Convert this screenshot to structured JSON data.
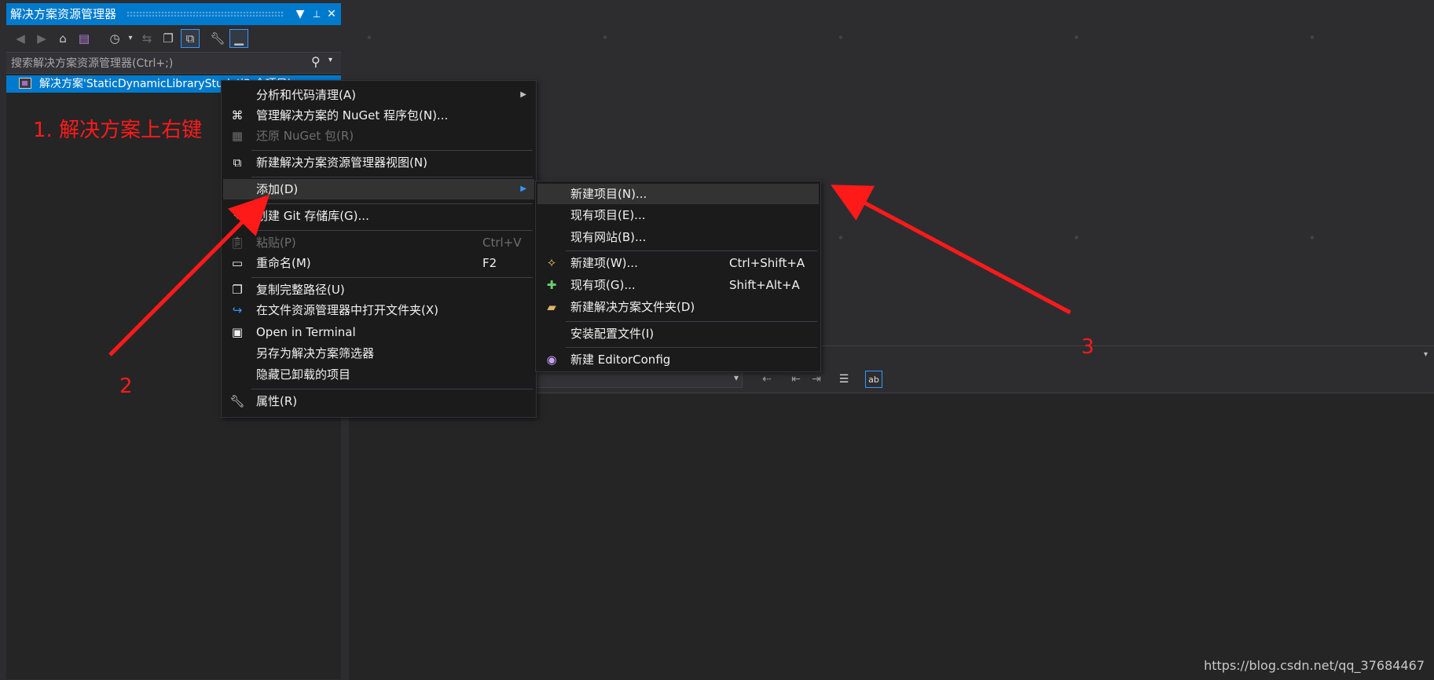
{
  "solution_explorer": {
    "title": "解决方案资源管理器",
    "title_buttons": [
      "▼",
      "📌",
      "✕"
    ],
    "toolbar_icons": [
      "back-icon",
      "forward-icon",
      "home-icon",
      "switch-views-icon",
      "history-icon",
      "sync-icon",
      "collapse-all-icon",
      "show-all-files-icon",
      "properties-icon",
      "preview-icon"
    ],
    "search_placeholder": "搜索解决方案资源管理器(Ctrl+;)",
    "tree_item": "解决方案'StaticDynamicLibraryStudy'(2 个项目)"
  },
  "context_menu": {
    "items": [
      {
        "label": "分析和代码清理(A)",
        "shortcut": "",
        "submenu": true,
        "icon": ""
      },
      {
        "label": "管理解决方案的 NuGet 程序包(N)...",
        "shortcut": "",
        "icon": "nuget-icon"
      },
      {
        "label": "还原 NuGet 包(R)",
        "shortcut": "",
        "icon": "restore-icon",
        "disabled": true
      },
      {
        "label": "新建解决方案资源管理器视图(N)",
        "shortcut": "",
        "icon": "new-view-icon"
      },
      {
        "label": "添加(D)",
        "shortcut": "",
        "submenu": true,
        "highlighted": true
      },
      {
        "label": "创建 Git 存储库(G)...",
        "shortcut": "",
        "icon": "git-icon"
      },
      {
        "label": "粘贴(P)",
        "shortcut": "Ctrl+V",
        "icon": "paste-icon",
        "disabled": true
      },
      {
        "label": "重命名(M)",
        "shortcut": "F2",
        "icon": "rename-icon"
      },
      {
        "label": "复制完整路径(U)",
        "shortcut": "",
        "icon": "copy-icon"
      },
      {
        "label": "在文件资源管理器中打开文件夹(X)",
        "shortcut": "",
        "icon": "open-folder-icon"
      },
      {
        "label": "Open in Terminal",
        "shortcut": "",
        "icon": "terminal-icon"
      },
      {
        "label": "另存为解决方案筛选器",
        "shortcut": ""
      },
      {
        "label": "隐藏已卸载的项目",
        "shortcut": ""
      },
      {
        "label": "属性(R)",
        "shortcut": "",
        "icon": "wrench-icon"
      }
    ]
  },
  "add_submenu": {
    "items": [
      {
        "label": "新建项目(N)...",
        "shortcut": "",
        "highlighted": true
      },
      {
        "label": "现有项目(E)...",
        "shortcut": ""
      },
      {
        "label": "现有网站(B)...",
        "shortcut": ""
      },
      {
        "label": "新建项(W)...",
        "shortcut": "Ctrl+Shift+A",
        "icon": "new-item-icon"
      },
      {
        "label": "现有项(G)...",
        "shortcut": "Shift+Alt+A",
        "icon": "existing-item-icon"
      },
      {
        "label": "新建解决方案文件夹(D)",
        "shortcut": "",
        "icon": "new-folder-icon"
      },
      {
        "label": "安装配置文件(I)",
        "shortcut": ""
      },
      {
        "label": "新建 EditorConfig",
        "shortcut": "",
        "icon": "editorconfig-icon"
      }
    ]
  },
  "annotations": {
    "step1": "1. 解决方案上右键",
    "step2": "2",
    "step3": "3",
    "color": "#ff1a1a"
  },
  "watermark": "https://blog.csdn.net/qq_37684467"
}
